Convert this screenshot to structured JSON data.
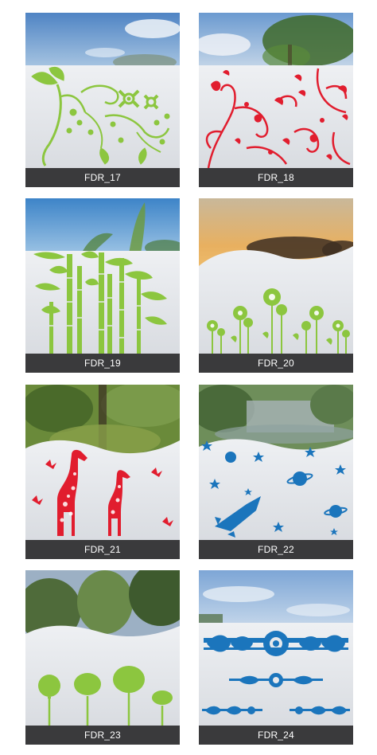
{
  "products": [
    {
      "code": "FDR_17",
      "motif": "green floral vine with butterfly",
      "color": "#8cc63f"
    },
    {
      "code": "FDR_18",
      "motif": "red swirl flowers",
      "color": "#e11d2e"
    },
    {
      "code": "FDR_19",
      "motif": "green bamboo stalks",
      "color": "#8cc63f"
    },
    {
      "code": "FDR_20",
      "motif": "green daisy flowers",
      "color": "#8cc63f"
    },
    {
      "code": "FDR_21",
      "motif": "red giraffes and butterflies",
      "color": "#e11d2e"
    },
    {
      "code": "FDR_22",
      "motif": "blue rocket, planets and stars",
      "color": "#1b75bc"
    },
    {
      "code": "FDR_23",
      "motif": "green trees",
      "color": "#8cc63f"
    },
    {
      "code": "FDR_24",
      "motif": "blue ornamental border",
      "color": "#1b75bc"
    }
  ]
}
